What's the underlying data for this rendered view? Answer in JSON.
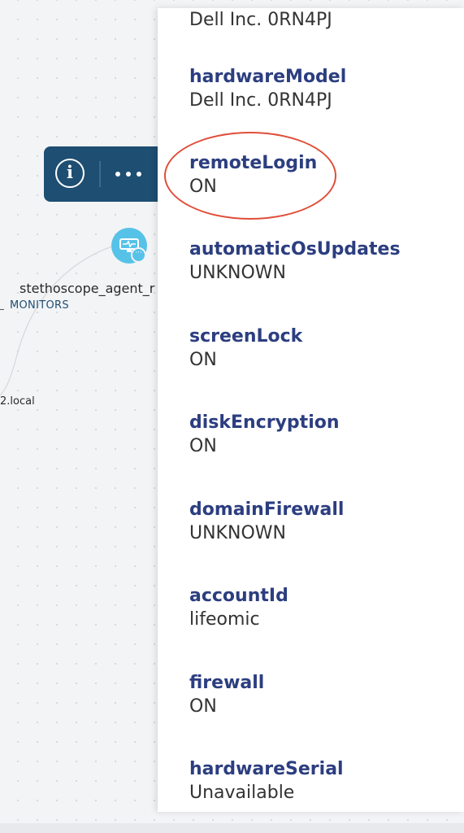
{
  "toolbar": {
    "info_icon": "info-icon",
    "more_icon": "more-horizontal-icon"
  },
  "graph": {
    "node_icon": "monitor-heartbeat-icon",
    "node_label": "stethoscope_agent_r",
    "edge_label": "MONITORS",
    "host_label": "2.local"
  },
  "panel": {
    "top_value": "Dell Inc. 0RN4PJ",
    "fields": [
      {
        "key": "hardwareModel",
        "value": "Dell Inc. 0RN4PJ"
      },
      {
        "key": "remoteLogin",
        "value": "ON"
      },
      {
        "key": "automaticOsUpdates",
        "value": "UNKNOWN"
      },
      {
        "key": "screenLock",
        "value": "ON"
      },
      {
        "key": "diskEncryption",
        "value": "ON"
      },
      {
        "key": "domainFirewall",
        "value": "UNKNOWN"
      },
      {
        "key": "accountId",
        "value": "lifeomic"
      },
      {
        "key": "firewall",
        "value": "ON"
      },
      {
        "key": "hardwareSerial",
        "value": "Unavailable"
      }
    ]
  },
  "colors": {
    "toolbar": "#1e4e72",
    "node": "#56c2e8",
    "key_text": "#2c3e80",
    "highlight": "#e04e3a"
  }
}
